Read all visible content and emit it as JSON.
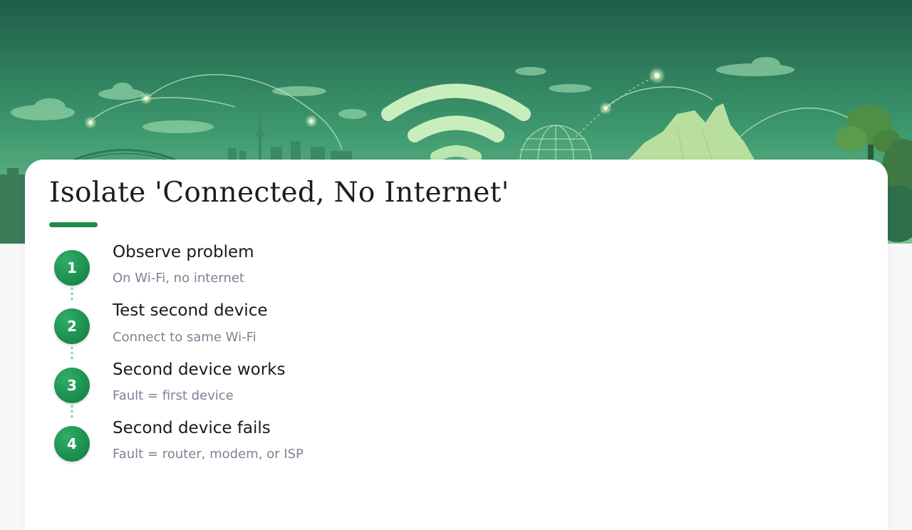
{
  "page": {
    "title": "Isolate 'Connected, No Internet'"
  },
  "colors": {
    "accent": "#1f8a4c",
    "banner_top": "#1d5e48",
    "banner_bottom": "#7cc79a",
    "step_circle": "#1a8a4a"
  },
  "banner": {
    "icons": [
      "wifi-icon",
      "globe-icon",
      "harbour-bridge-icon",
      "city-skyline-icon",
      "tree-icon",
      "map-icon"
    ]
  },
  "steps": [
    {
      "number": "1",
      "title": "Observe problem",
      "subtitle": "On Wi-Fi, no internet"
    },
    {
      "number": "2",
      "title": "Test second device",
      "subtitle": "Connect to same Wi-Fi"
    },
    {
      "number": "3",
      "title": "Second device works",
      "subtitle": "Fault = first device"
    },
    {
      "number": "4",
      "title": "Second device fails",
      "subtitle": "Fault = router, modem, or ISP"
    }
  ]
}
